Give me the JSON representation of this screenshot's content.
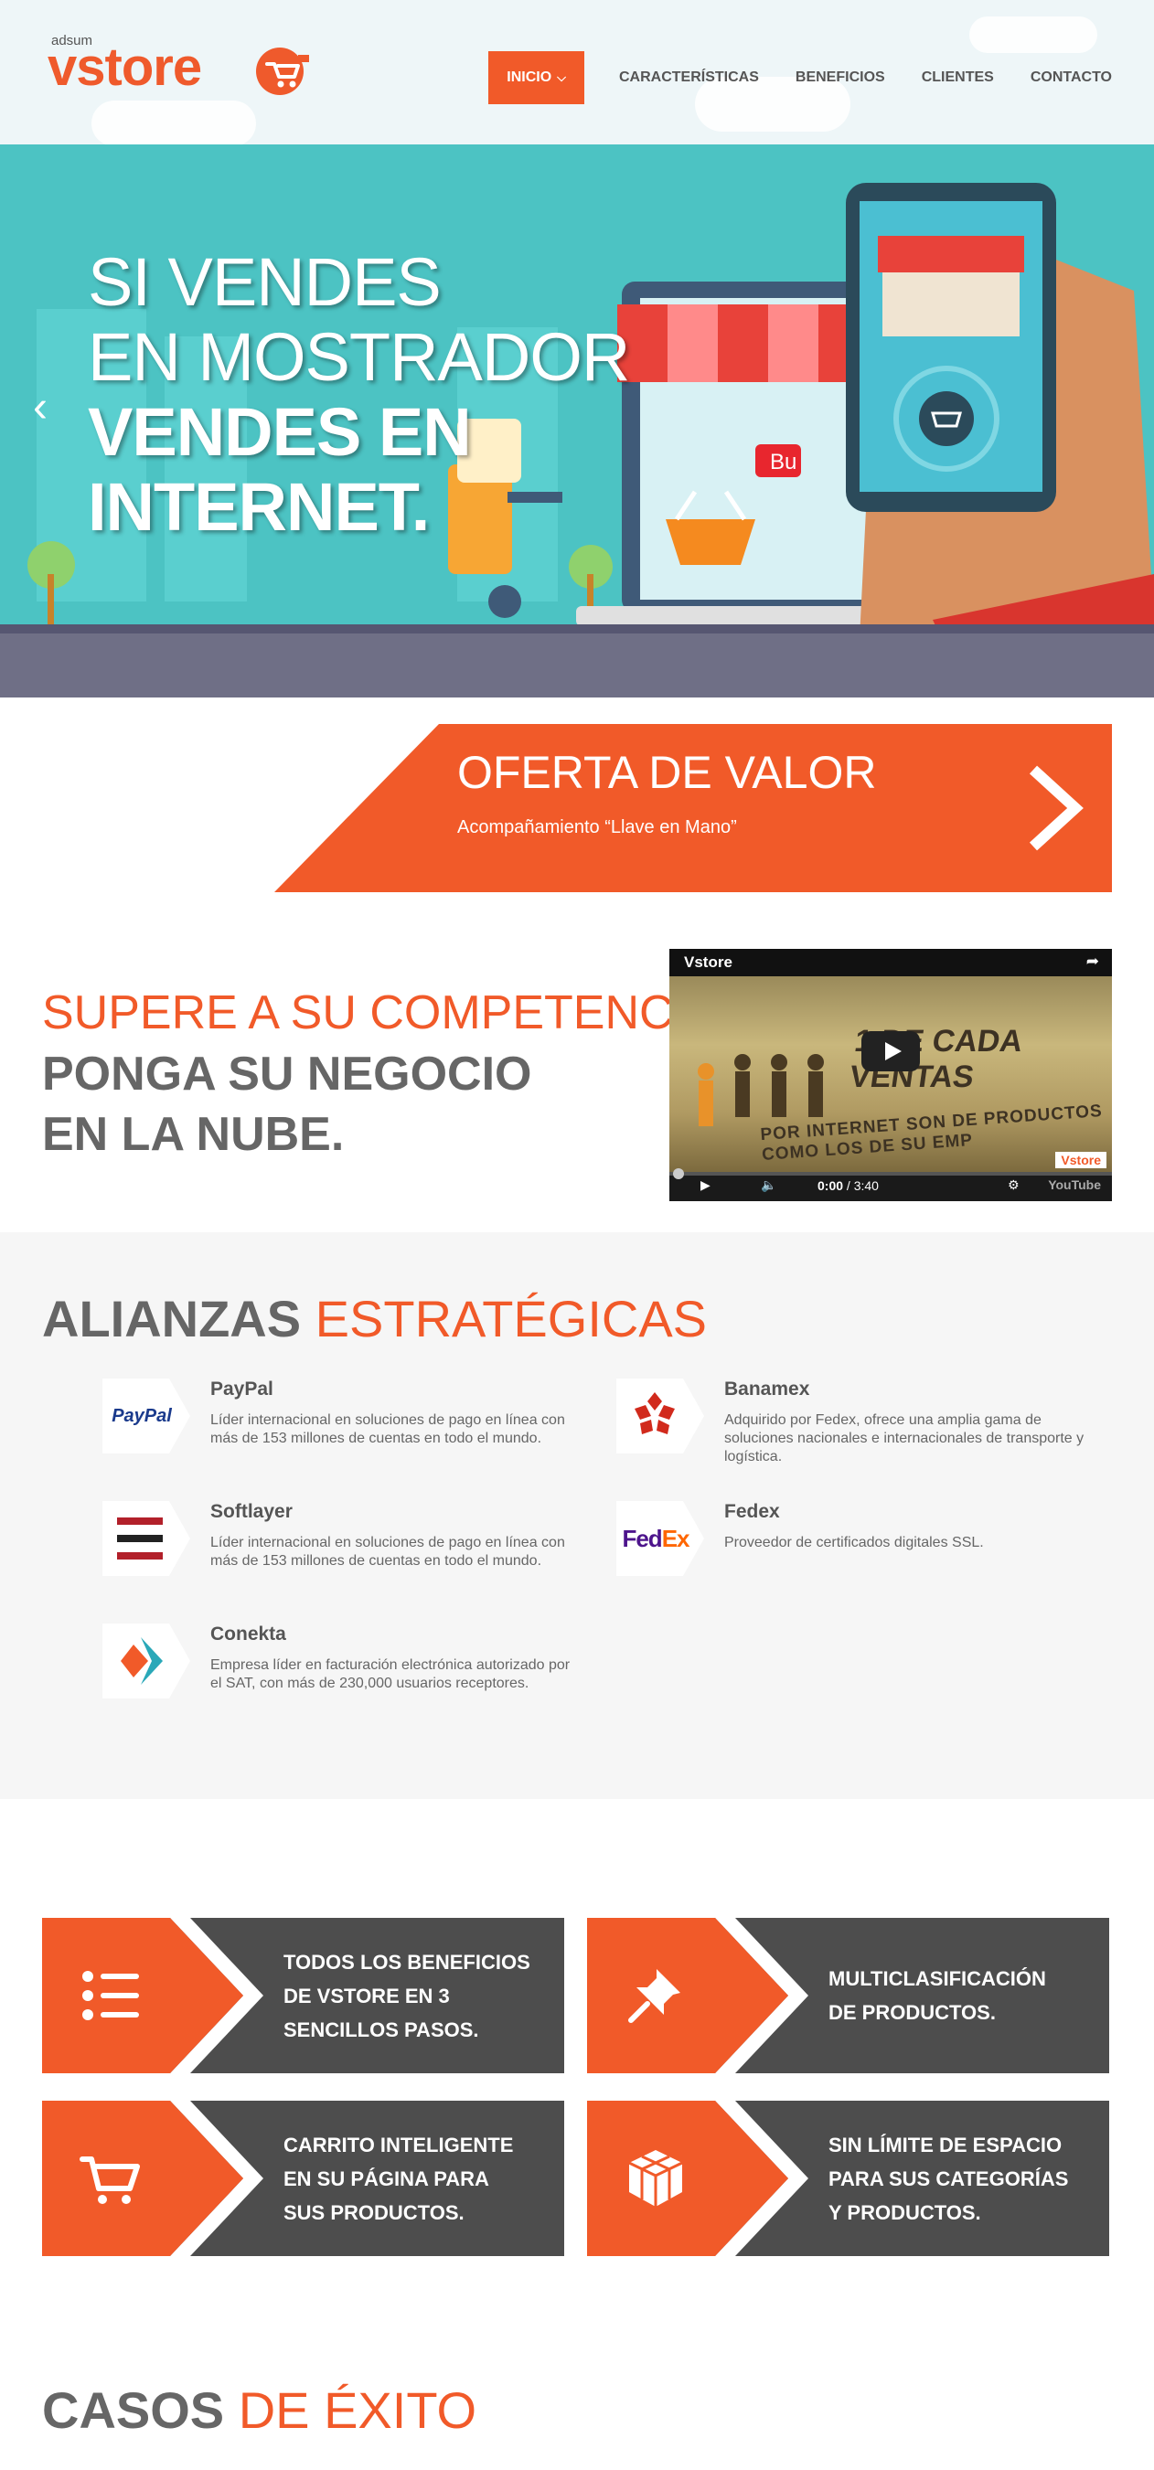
{
  "header": {
    "logo_small": "adsum",
    "logo_main": "vstore",
    "nav": [
      {
        "label": "INICIO",
        "active": true
      },
      {
        "label": "CARACTERÍSTICAS",
        "active": false
      },
      {
        "label": "BENEFICIOS",
        "active": false
      },
      {
        "label": "CLIENTES",
        "active": false
      },
      {
        "label": "CONTACTO",
        "active": false
      }
    ]
  },
  "hero": {
    "lines": [
      "SI VENDES",
      "EN MOSTRADOR",
      "VENDES EN",
      "INTERNET."
    ],
    "button_fragment": "Bu"
  },
  "oferta": {
    "title": "OFERTA DE VALOR",
    "subtitle": "Acompañamiento “Llave en Mano”"
  },
  "supere": {
    "line1": "SUPERE A SU COMPETENCIA",
    "line2": "PONGA SU NEGOCIO",
    "line3": "EN LA NUBE."
  },
  "video": {
    "title": "Vstore",
    "overlay_line1": "1 DE CADA",
    "overlay_line2": "VENTAS",
    "overlay_line3": "POR INTERNET SON DE PRODUCTOS",
    "overlay_line4": "COMO LOS DE SU EMP",
    "brand_badge": "Vstore",
    "time_current": "0:00",
    "time_total": "/ 3:40",
    "youtube": "YouTube"
  },
  "alianzas": {
    "title_dark": "ALIANZAS",
    "title_orange": "ESTRATÉGICAS",
    "partners": [
      {
        "name": "PayPal",
        "logo_text": "PayPal",
        "desc": "Líder internacional en soluciones de pago en línea con más de 153 millones de cuentas en todo el mundo."
      },
      {
        "name": "Banamex",
        "logo_text": "",
        "desc": "Adquirido por Fedex, ofrece una amplia gama de soluciones nacionales e internacionales de transporte y logística."
      },
      {
        "name": "Softlayer",
        "logo_text": "",
        "desc": "Líder internacional en soluciones de pago en línea con más de 153 millones de cuentas en todo el mundo."
      },
      {
        "name": "Fedex",
        "logo_text_a": "Fed",
        "logo_text_b": "Ex",
        "desc": "Proveedor de certificados digitales SSL."
      },
      {
        "name": "Conekta",
        "logo_text": "",
        "desc": "Empresa líder en facturación electrónica autorizado por el SAT, con más de 230,000 usuarios receptores."
      }
    ]
  },
  "features": [
    {
      "icon": "list-icon",
      "lines": [
        "TODOS LOS BENEFICIOS",
        "DE VSTORE EN 3",
        "SENCILLOS PASOS."
      ]
    },
    {
      "icon": "pin-icon",
      "lines": [
        "MULTICLASIFICACIÓN",
        "DE PRODUCTOS."
      ]
    },
    {
      "icon": "cart-icon",
      "lines": [
        "CARRITO INTELIGENTE",
        "EN SU PÁGINA PARA",
        "SUS PRODUCTOS."
      ]
    },
    {
      "icon": "box-icon",
      "lines": [
        "SIN LÍMITE DE ESPACIO",
        "PARA SUS CATEGORÍAS",
        "Y PRODUCTOS."
      ]
    }
  ],
  "casos": {
    "title_dark": "CASOS",
    "title_orange": "DE ÉXITO"
  },
  "colors": {
    "accent": "#f15a29",
    "dark": "#4d4d4d",
    "teal": "#4cc3c3",
    "light_bg": "#f6f6f6"
  }
}
